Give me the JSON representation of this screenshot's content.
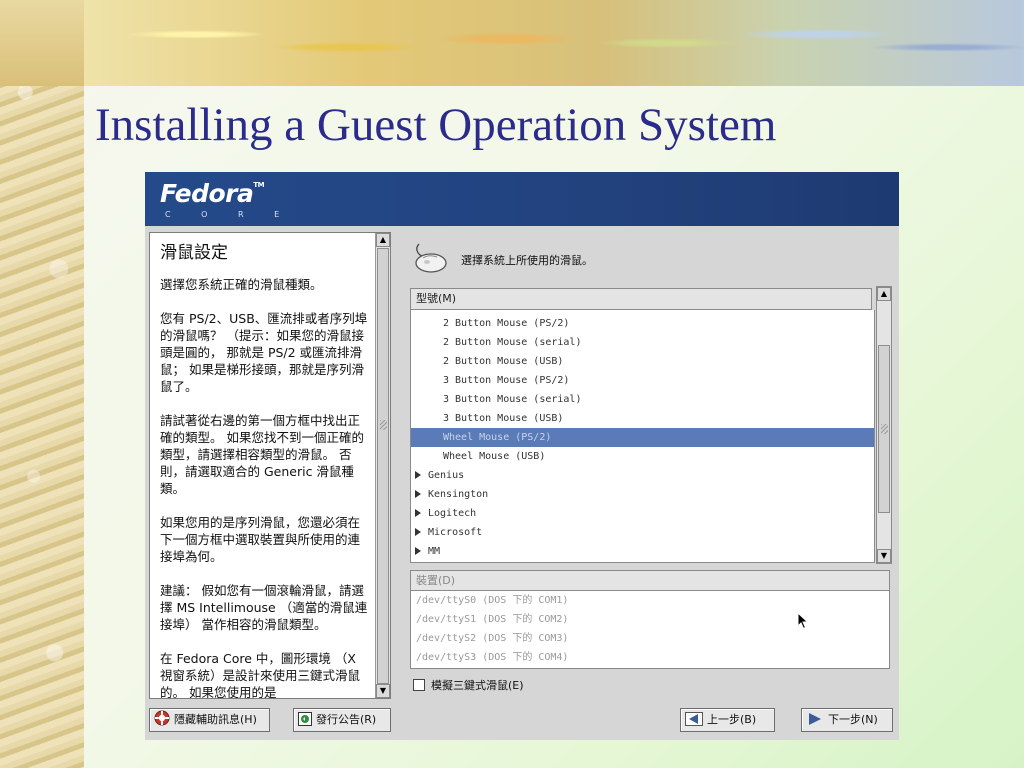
{
  "slide": {
    "title": "Installing a Guest Operation System"
  },
  "installer": {
    "brand": "Fedora",
    "brand_tm": "TM",
    "brand_sub": "C O R E",
    "help": {
      "title": "滑鼠設定",
      "paragraphs": [
        "選擇您系統正確的滑鼠種類。",
        "您有 PS/2、USB、匯流排或者序列埠的滑鼠嗎？ （提示：如果您的滑鼠接頭是圓的， 那就是 PS/2 或匯流排滑鼠； 如果是梯形接頭，那就是序列滑鼠了。",
        "請試著從右邊的第一個方框中找出正確的類型。 如果您找不到一個正確的類型，請選擇相容類型的滑鼠。 否則，請選取適合的 Generic 滑鼠種類。",
        "如果您用的是序列滑鼠，您還必須在下一個方框中選取裝置與所使用的連接埠為何。",
        "建議： 假如您有一個滾輪滑鼠，請選擇 MS Intellimouse （適當的滑鼠連接埠） 當作相容的滑鼠類型。",
        "在 Fedora Core 中，圖形環境 （X 視窗系統）是設計來使用三鍵式滑鼠的。 如果您使用的是"
      ]
    },
    "instruction": "選擇系統上所使用的滑鼠。",
    "model_header": "型號(M)",
    "models": [
      {
        "label": "2 Button Mouse (PS/2)",
        "kind": "child",
        "selected": false
      },
      {
        "label": "2 Button Mouse (serial)",
        "kind": "child",
        "selected": false
      },
      {
        "label": "2 Button Mouse (USB)",
        "kind": "child",
        "selected": false
      },
      {
        "label": "3 Button Mouse (PS/2)",
        "kind": "child",
        "selected": false
      },
      {
        "label": "3 Button Mouse (serial)",
        "kind": "child",
        "selected": false
      },
      {
        "label": "3 Button Mouse (USB)",
        "kind": "child",
        "selected": false
      },
      {
        "label": "Wheel Mouse (PS/2)",
        "kind": "child",
        "selected": true
      },
      {
        "label": "Wheel Mouse (USB)",
        "kind": "child",
        "selected": false
      },
      {
        "label": "Genius",
        "kind": "group",
        "selected": false
      },
      {
        "label": "Kensington",
        "kind": "group",
        "selected": false
      },
      {
        "label": "Logitech",
        "kind": "group",
        "selected": false
      },
      {
        "label": "Microsoft",
        "kind": "group",
        "selected": false
      },
      {
        "label": "MM",
        "kind": "group",
        "selected": false
      }
    ],
    "device_header": "裝置(D)",
    "devices": [
      "/dev/ttyS0 (DOS 下的 COM1)",
      "/dev/ttyS1 (DOS 下的 COM2)",
      "/dev/ttyS2 (DOS 下的 COM3)",
      "/dev/ttyS3 (DOS 下的 COM4)"
    ],
    "emulate_label": "模擬三鍵式滑鼠(E)",
    "emulate_checked": false,
    "buttons": {
      "hide_help": "隱藏輔助訊息(H)",
      "release_notes": "發行公告(R)",
      "back": "上一步(B)",
      "next": "下一步(N)"
    },
    "colors": {
      "header_blue": "#22427e",
      "selection": "#5a7ab8",
      "title_blue": "#2b2b8c"
    }
  }
}
